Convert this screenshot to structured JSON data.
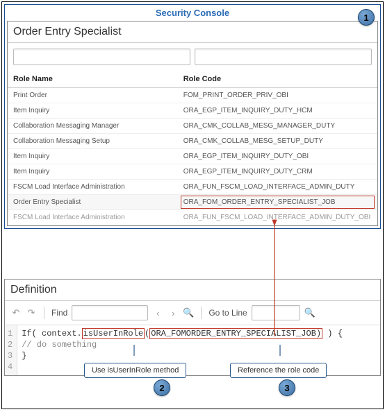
{
  "security_console": {
    "title": "Security Console",
    "page_heading": "Order Entry Specialist",
    "search": {
      "name_placeholder": "",
      "code_placeholder": ""
    },
    "columns": {
      "name": "Role Name",
      "code": "Role Code"
    },
    "rows": [
      {
        "name": "Print Order",
        "code": "FOM_PRINT_ORDER_PRIV_OBI"
      },
      {
        "name": "Item Inquiry",
        "code": "ORA_EGP_ITEM_INQUIRY_DUTY_HCM"
      },
      {
        "name": "Collaboration Messaging Manager",
        "code": "ORA_CMK_COLLAB_MESG_MANAGER_DUTY"
      },
      {
        "name": "Collaboration Messaging Setup",
        "code": "ORA_CMK_COLLAB_MESG_SETUP_DUTY"
      },
      {
        "name": "Item Inquiry",
        "code": "ORA_EGP_ITEM_INQUIRY_DUTY_OBI"
      },
      {
        "name": "Item Inquiry",
        "code": "ORA_EGP_ITEM_INQUIRY_DUTY_CRM"
      },
      {
        "name": "FSCM Load Interface Administration",
        "code": "ORA_FUN_FSCM_LOAD_INTERFACE_ADMIN_DUTY"
      },
      {
        "name": "Order Entry Specialist",
        "code": "ORA_FOM_ORDER_ENTRY_SPECIALIST_JOB",
        "highlight": true
      },
      {
        "name": "FSCM Load Interface Administration",
        "code": "ORA_FUN_FSCM_LOAD_INTERFACE_ADMIN_DUTY_OBI",
        "cut": true
      }
    ]
  },
  "definition": {
    "title": "Definition",
    "toolbar": {
      "undo_icon": "↶",
      "redo_icon": "↷",
      "find_label": "Find",
      "find_value": "",
      "prev_icon": "‹",
      "next_icon": "›",
      "search_icon": "🔍",
      "goto_label": "Go to Line",
      "goto_value": "",
      "goto_icon": "🔍"
    },
    "code": {
      "line1_prefix": "If( context.",
      "line1_method": "isUserInRole",
      "line1_open": "(",
      "line1_arg": "ORA_FOMORDER_ENTRY_SPECIALIST_JOB)",
      "line1_suffix": " ) {",
      "line2": "// do something",
      "line3": "}",
      "line4": ""
    }
  },
  "callouts": {
    "badge1": "1",
    "badge2": "2",
    "badge3": "3",
    "label_method": "Use isUserInRole method",
    "label_rolecode": "Reference the role code"
  },
  "colors": {
    "accent_red": "#c0392b",
    "accent_blue": "#1a4f8f"
  }
}
